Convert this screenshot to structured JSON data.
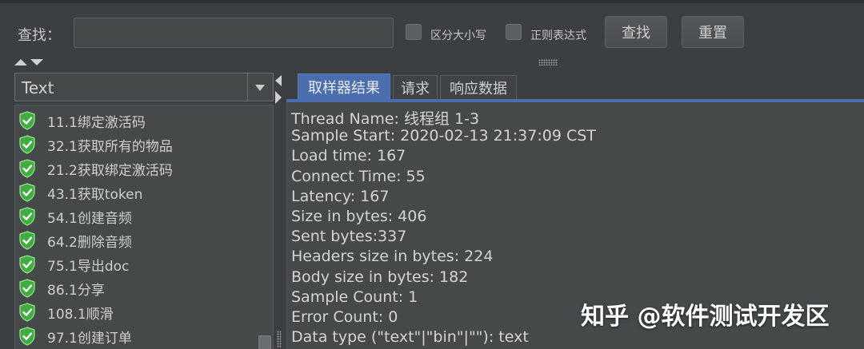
{
  "search": {
    "label": "查找：",
    "value": "",
    "case_sensitive_label": "区分大小写",
    "regex_label": "正则表达式",
    "find_button": "查找",
    "reset_button": "重置"
  },
  "renderer_select": {
    "selected": "Text"
  },
  "tree": {
    "items": [
      {
        "label": "11.1绑定激活码",
        "status": "success"
      },
      {
        "label": "32.1获取所有的物品",
        "status": "success"
      },
      {
        "label": "21.2获取绑定激活码",
        "status": "success"
      },
      {
        "label": "43.1获取token",
        "status": "success"
      },
      {
        "label": "54.1创建音频",
        "status": "success"
      },
      {
        "label": "64.2删除音频",
        "status": "success"
      },
      {
        "label": "75.1导出doc",
        "status": "success"
      },
      {
        "label": "86.1分享",
        "status": "success"
      },
      {
        "label": "108.1顺滑",
        "status": "success"
      },
      {
        "label": "97.1创建订单",
        "status": "success"
      }
    ]
  },
  "tabs": [
    {
      "label": "取样器结果",
      "active": true
    },
    {
      "label": "请求",
      "active": false
    },
    {
      "label": "响应数据",
      "active": false
    }
  ],
  "sampler_result": {
    "lines": [
      "Thread Name: 线程组 1-3",
      "Sample Start: 2020-02-13 21:37:09 CST",
      "Load time: 167",
      "Connect Time: 55",
      "Latency: 167",
      "Size in bytes: 406",
      "Sent bytes:337",
      "Headers size in bytes: 224",
      "Body size in bytes: 182",
      "Sample Count: 1",
      "Error Count: 0",
      "Data type (\"text\"|\"bin\"|\"\"): text"
    ]
  },
  "watermark": "知乎 @软件测试开发区",
  "colors": {
    "background": "#3c3f41",
    "panel": "#45494a",
    "accent": "#4b6eaf",
    "success": "#3fae3f"
  },
  "icons": {
    "success": "shield-check-icon",
    "dropdown": "chevron-down-icon"
  }
}
